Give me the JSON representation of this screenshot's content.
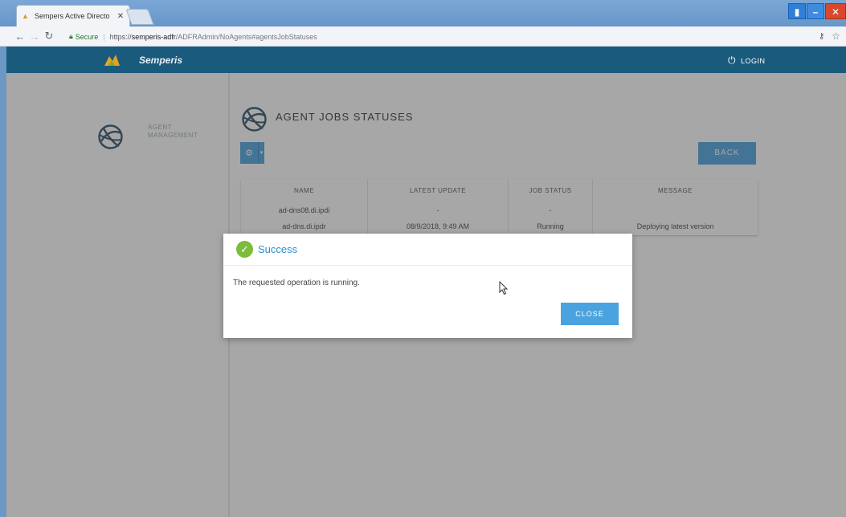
{
  "browser": {
    "tab_title": "Sempers Active Directo",
    "tab_close": "✕",
    "address": {
      "secure_label": "Secure",
      "url_proto": "https://",
      "url_host": "semperis-adfr",
      "url_path": "/ADFRAdmin/NoAgents#agentsJobStatuses"
    },
    "window_buttons": {
      "minimize": "▮",
      "dash": "–",
      "close": "✕"
    }
  },
  "app": {
    "brand_name": "Semperis",
    "login_label": "LOGIN",
    "sidebar": {
      "item_label_line1": "AGENT",
      "item_label_line2": "MANAGEMENT"
    },
    "main": {
      "heading": "AGENT JOBS STATUSES",
      "back_button": "BACK",
      "table": {
        "headers": [
          "NAME",
          "LATEST UPDATE",
          "JOB STATUS",
          "MESSAGE"
        ],
        "rows": [
          [
            "ad-dns08.di.ipdi",
            "-",
            "-",
            ""
          ],
          [
            "ad-dns.di.ipdr",
            "08/9/2018, 9:49 AM",
            "Running",
            "Deploying latest version"
          ]
        ]
      }
    }
  },
  "modal": {
    "title": "Success",
    "message": "The requested operation is running.",
    "close_button": "CLOSE"
  },
  "colors": {
    "appbar": "#1a5a7d",
    "accent": "#4aa3df",
    "success": "#7dbb3a",
    "title_blue": "#2d8fd2"
  },
  "icons": [
    "globe-icon",
    "gear-icon",
    "check-circle-icon",
    "power-icon",
    "lock-icon",
    "key-icon",
    "star-icon",
    "mouse-cursor-icon"
  ]
}
